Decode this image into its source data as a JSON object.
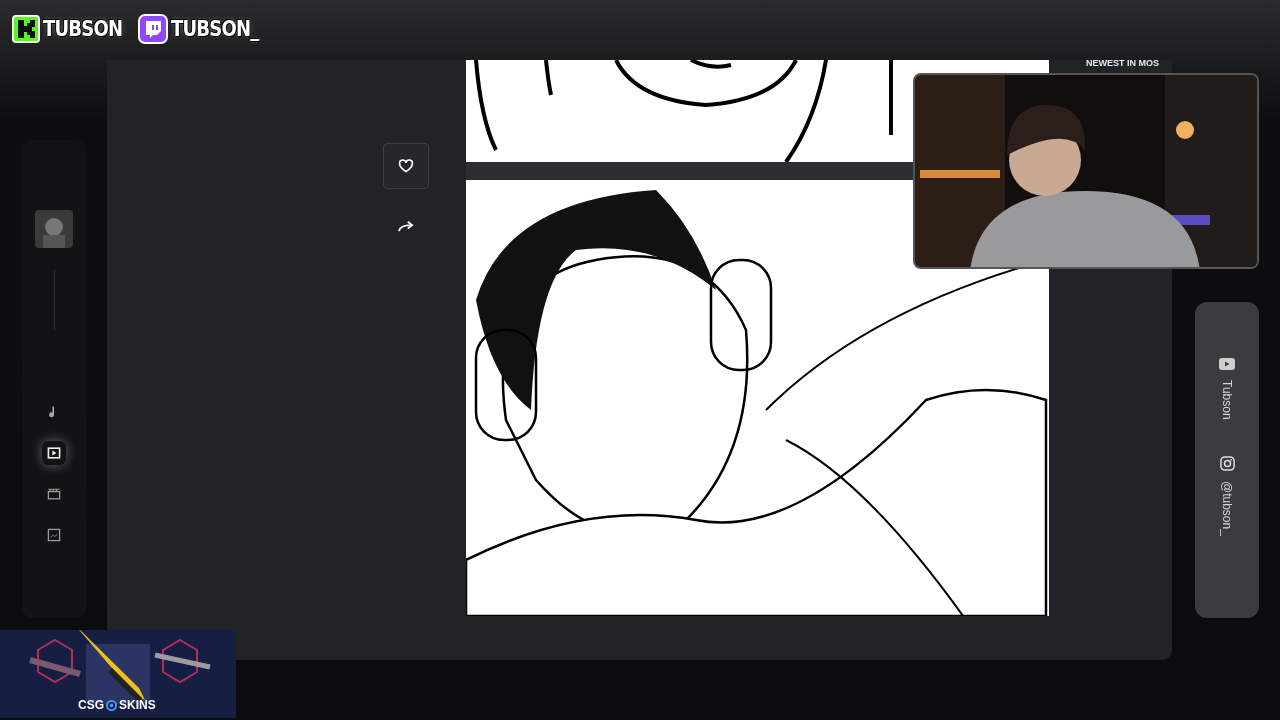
{
  "stream_labels": [
    {
      "kind": "kick",
      "text": "TUBSON"
    },
    {
      "kind": "twitch",
      "text": "TUBSON_"
    }
  ],
  "sidebar": {
    "nav_icons": [
      {
        "selected": false
      },
      {
        "selected": true
      },
      {
        "selected": false
      },
      {
        "selected": false
      }
    ]
  },
  "post": {
    "liked": false
  },
  "webcam": {
    "kind": "picture",
    "banner": "NEWEST IN MOS"
  },
  "socials": [
    {
      "kind": "youtube",
      "handle": "Tubson"
    },
    {
      "kind": "instagram",
      "handle": "@tubson_"
    }
  ],
  "sponsor": {
    "brand_left": "CSG",
    "brand_right": "SKINS"
  }
}
